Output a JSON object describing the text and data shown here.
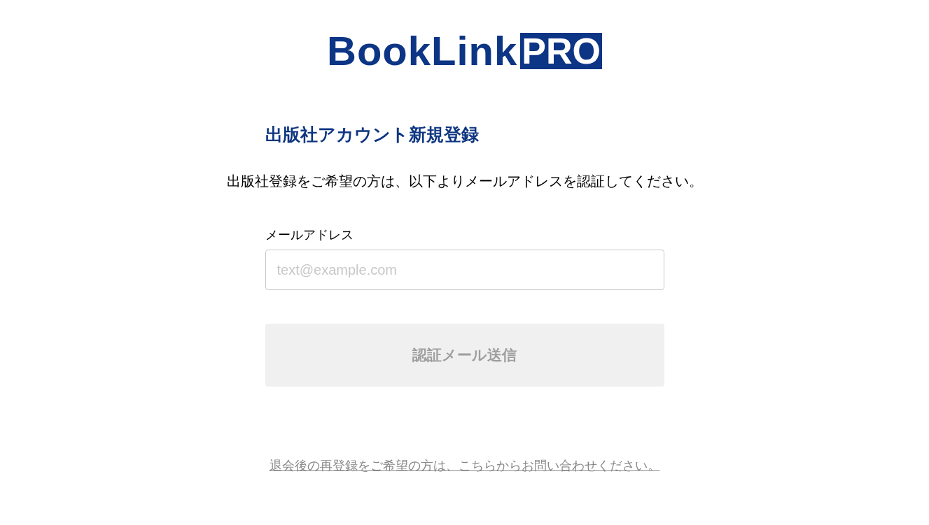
{
  "logo": {
    "name": "BookLink",
    "badge": "PRO"
  },
  "title": "出版社アカウント新規登録",
  "intro": "出版社登録をご希望の方は、以下よりメールアドレスを認証してください。",
  "email_field": {
    "label": "メールアドレス",
    "placeholder": "text@example.com"
  },
  "submit_button": {
    "label": "認証メール送信",
    "disabled": true
  },
  "footer_link": "退会後の再登録をご希望の方は、こちらからお問い合わせください。"
}
